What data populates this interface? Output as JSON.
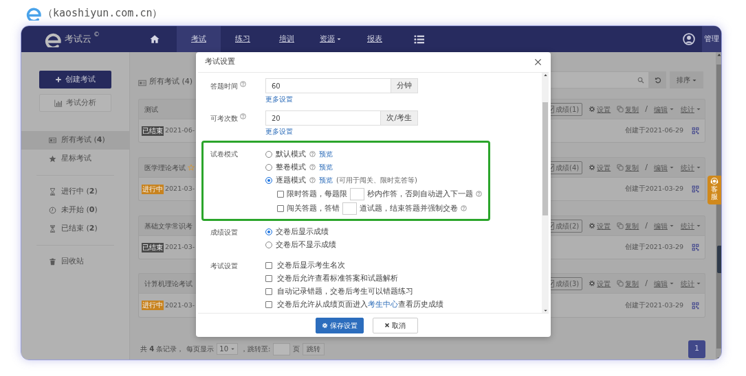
{
  "caption": "（kaoshiyun.com.cn）",
  "navbar": {
    "brand": "考试云",
    "brand_mark": "©",
    "items": [
      {
        "kind": "home",
        "selected": false
      },
      {
        "kind": "text",
        "label": "考试",
        "selected": true
      },
      {
        "kind": "text",
        "label": "练习",
        "selected": false
      },
      {
        "kind": "text",
        "label": "培训",
        "selected": false
      },
      {
        "kind": "dropdown",
        "label": "资源",
        "selected": false
      },
      {
        "kind": "text",
        "label": "报表",
        "selected": false
      },
      {
        "kind": "menu",
        "selected": false
      }
    ],
    "user": "管理"
  },
  "sidebar": {
    "create_button": "创建考试",
    "analysis_button": "考试分析",
    "groups": [
      [
        {
          "kind": "all",
          "label": "所有考试 (**4**)",
          "selected": true
        },
        {
          "kind": "star",
          "label": "星标考试",
          "selected": false
        }
      ],
      [
        {
          "kind": "ongoing",
          "label": "进行中 (**2**)",
          "selected": false
        },
        {
          "kind": "pending",
          "label": "未开始 (**0**)",
          "selected": false
        },
        {
          "kind": "ended",
          "label": "已结束 (**2**)",
          "selected": false
        }
      ],
      [
        {
          "kind": "trash",
          "label": "回收站",
          "selected": false
        }
      ]
    ]
  },
  "main": {
    "title": "所有考试 (4)",
    "sort_button": "排序"
  },
  "exams": [
    {
      "title": "测试",
      "starred": false,
      "status": {
        "label": "已结束",
        "color": "#4b4b4b"
      },
      "date": "2021-06-",
      "score_button": "成绩(1)",
      "settings": "设置",
      "copy": "复制",
      "separator": "/",
      "edit": "编辑",
      "stats": "统计",
      "created": "创建于2021-06-29"
    },
    {
      "title": "医学理论考试",
      "starred": true,
      "status": {
        "label": "进行中",
        "color": "#c8831f"
      },
      "date": "2021-03-",
      "score_button": "成绩(4)",
      "settings": "设置",
      "copy": "复制",
      "separator": "/",
      "edit": "编辑",
      "stats": "统计",
      "created": "创建于2021-03-29"
    },
    {
      "title": "基础文学常识考",
      "starred": false,
      "status": {
        "label": "已结束",
        "color": "#4b4b4b"
      },
      "date": "2021-03-",
      "score_button": "成绩(2)",
      "settings": "设置",
      "copy": "复制",
      "separator": "/",
      "edit": "编辑",
      "stats": "统计",
      "created": "创建于2021-03-29"
    },
    {
      "title": "计算机理论考试",
      "starred": false,
      "status": {
        "label": "进行中",
        "color": "#c8831f"
      },
      "date": "2021-03-",
      "score_button": "成绩(3)",
      "settings": "设置",
      "copy": "复制",
      "separator": "/",
      "edit": "编辑",
      "stats": "统计",
      "created": "创建于2021-03-29"
    }
  ],
  "footer": {
    "total": "共 **4** 条记录，",
    "per_page_label": "每页显示",
    "per_page": "10",
    "jump_label": "，跳转至:",
    "page_unit": "页",
    "jump_button": "跳转",
    "pages": [
      {
        "label": "1",
        "selected": true
      }
    ]
  },
  "support_tab": "客服",
  "modal": {
    "title": "考试设置",
    "fields": [
      {
        "label": "答题时间",
        "value": "60",
        "unit": "分钟",
        "link": "更多设置"
      },
      {
        "label": "可考次数",
        "value": "20",
        "unit": "次/考生",
        "link": "更多设置"
      }
    ],
    "paper_mode": {
      "label": "试卷模式",
      "highlighted": true,
      "options": [
        {
          "label": "默认模式",
          "preview": "预览",
          "selected": false
        },
        {
          "label": "整卷模式",
          "preview": "预览",
          "selected": false
        },
        {
          "label": "逐题模式",
          "preview": "预览",
          "note": "(可用于闯关、限时竞答等)",
          "selected": true
        }
      ],
      "sub_options": [
        {
          "before": "限时答题，每题限",
          "after": "秒内作答，否则自动进入下一题",
          "checked": false
        },
        {
          "before": "闯关答题，答错",
          "after": "道试题，结束答题并强制交卷",
          "checked": false
        }
      ]
    },
    "score_setting": {
      "label": "成绩设置",
      "options": [
        {
          "label": "交卷后显示成绩",
          "selected": true
        },
        {
          "label": "交卷后不显示成绩",
          "selected": false
        }
      ]
    },
    "exam_setting": {
      "label": "考试设置",
      "options": [
        {
          "label": "交卷后显示考生名次",
          "checked": false
        },
        {
          "label": "交卷后允许查看标准答案和试题解析",
          "checked": false
        },
        {
          "label": "自动记录错题，交卷后考生可以错题练习",
          "checked": false
        },
        {
          "label": "交卷后允许从成绩页面进入",
          "link": "考生中心",
          "suffix": "查看历史成绩",
          "checked": false
        }
      ]
    },
    "buttons": [
      {
        "kind": "primary",
        "label": "保存设置"
      },
      {
        "kind": "cancel",
        "label": "取消"
      }
    ]
  }
}
